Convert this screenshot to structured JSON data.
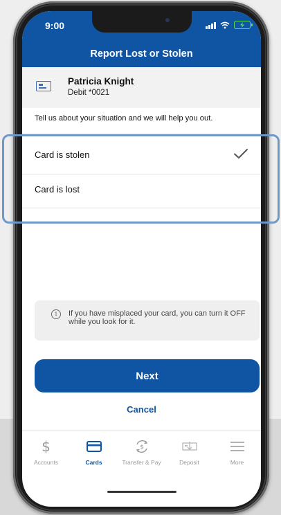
{
  "status_bar": {
    "time": "9:00"
  },
  "header": {
    "title": "Report Lost or Stolen"
  },
  "account": {
    "name": "Patricia Knight",
    "subtitle": "Debit *0021"
  },
  "intro_text": "Tell us about your situation and we will help you out.",
  "options": [
    {
      "label": "Card is stolen",
      "selected": true
    },
    {
      "label": "Card is lost",
      "selected": false
    }
  ],
  "info_box": {
    "icon": "info-icon",
    "text": "If you have misplaced your card, you can turn it OFF while you look for it."
  },
  "actions": {
    "next_label": "Next",
    "cancel_label": "Cancel"
  },
  "tabs": [
    {
      "label": "Accounts",
      "icon": "dollar-icon",
      "active": false
    },
    {
      "label": "Cards",
      "icon": "card-icon",
      "active": true
    },
    {
      "label": "Transfer & Pay",
      "icon": "transfer-icon",
      "active": false
    },
    {
      "label": "Deposit",
      "icon": "deposit-icon",
      "active": false
    },
    {
      "label": "More",
      "icon": "menu-icon",
      "active": false
    }
  ],
  "colors": {
    "brand_blue": "#0f55a4",
    "highlight": "#6f98c7"
  }
}
